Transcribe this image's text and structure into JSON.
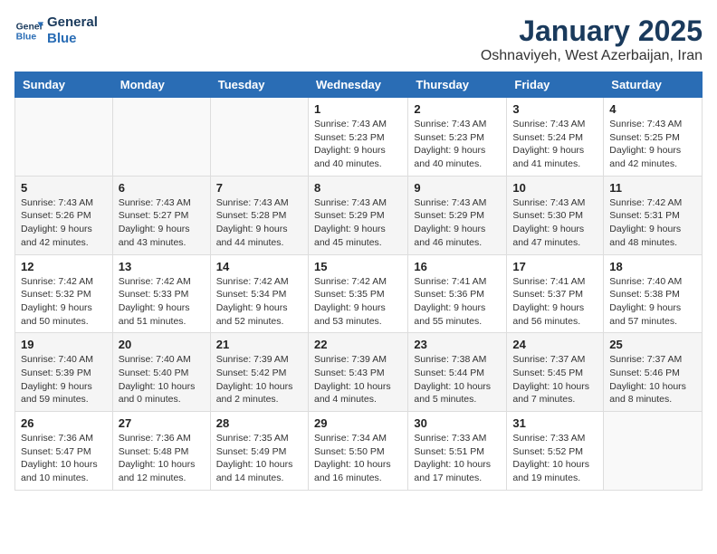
{
  "logo": {
    "line1": "General",
    "line2": "Blue"
  },
  "title": "January 2025",
  "location": "Oshnaviyeh, West Azerbaijan, Iran",
  "weekdays": [
    "Sunday",
    "Monday",
    "Tuesday",
    "Wednesday",
    "Thursday",
    "Friday",
    "Saturday"
  ],
  "weeks": [
    [
      {
        "day": "",
        "info": ""
      },
      {
        "day": "",
        "info": ""
      },
      {
        "day": "",
        "info": ""
      },
      {
        "day": "1",
        "info": "Sunrise: 7:43 AM\nSunset: 5:23 PM\nDaylight: 9 hours\nand 40 minutes."
      },
      {
        "day": "2",
        "info": "Sunrise: 7:43 AM\nSunset: 5:23 PM\nDaylight: 9 hours\nand 40 minutes."
      },
      {
        "day": "3",
        "info": "Sunrise: 7:43 AM\nSunset: 5:24 PM\nDaylight: 9 hours\nand 41 minutes."
      },
      {
        "day": "4",
        "info": "Sunrise: 7:43 AM\nSunset: 5:25 PM\nDaylight: 9 hours\nand 42 minutes."
      }
    ],
    [
      {
        "day": "5",
        "info": "Sunrise: 7:43 AM\nSunset: 5:26 PM\nDaylight: 9 hours\nand 42 minutes."
      },
      {
        "day": "6",
        "info": "Sunrise: 7:43 AM\nSunset: 5:27 PM\nDaylight: 9 hours\nand 43 minutes."
      },
      {
        "day": "7",
        "info": "Sunrise: 7:43 AM\nSunset: 5:28 PM\nDaylight: 9 hours\nand 44 minutes."
      },
      {
        "day": "8",
        "info": "Sunrise: 7:43 AM\nSunset: 5:29 PM\nDaylight: 9 hours\nand 45 minutes."
      },
      {
        "day": "9",
        "info": "Sunrise: 7:43 AM\nSunset: 5:29 PM\nDaylight: 9 hours\nand 46 minutes."
      },
      {
        "day": "10",
        "info": "Sunrise: 7:43 AM\nSunset: 5:30 PM\nDaylight: 9 hours\nand 47 minutes."
      },
      {
        "day": "11",
        "info": "Sunrise: 7:42 AM\nSunset: 5:31 PM\nDaylight: 9 hours\nand 48 minutes."
      }
    ],
    [
      {
        "day": "12",
        "info": "Sunrise: 7:42 AM\nSunset: 5:32 PM\nDaylight: 9 hours\nand 50 minutes."
      },
      {
        "day": "13",
        "info": "Sunrise: 7:42 AM\nSunset: 5:33 PM\nDaylight: 9 hours\nand 51 minutes."
      },
      {
        "day": "14",
        "info": "Sunrise: 7:42 AM\nSunset: 5:34 PM\nDaylight: 9 hours\nand 52 minutes."
      },
      {
        "day": "15",
        "info": "Sunrise: 7:42 AM\nSunset: 5:35 PM\nDaylight: 9 hours\nand 53 minutes."
      },
      {
        "day": "16",
        "info": "Sunrise: 7:41 AM\nSunset: 5:36 PM\nDaylight: 9 hours\nand 55 minutes."
      },
      {
        "day": "17",
        "info": "Sunrise: 7:41 AM\nSunset: 5:37 PM\nDaylight: 9 hours\nand 56 minutes."
      },
      {
        "day": "18",
        "info": "Sunrise: 7:40 AM\nSunset: 5:38 PM\nDaylight: 9 hours\nand 57 minutes."
      }
    ],
    [
      {
        "day": "19",
        "info": "Sunrise: 7:40 AM\nSunset: 5:39 PM\nDaylight: 9 hours\nand 59 minutes."
      },
      {
        "day": "20",
        "info": "Sunrise: 7:40 AM\nSunset: 5:40 PM\nDaylight: 10 hours\nand 0 minutes."
      },
      {
        "day": "21",
        "info": "Sunrise: 7:39 AM\nSunset: 5:42 PM\nDaylight: 10 hours\nand 2 minutes."
      },
      {
        "day": "22",
        "info": "Sunrise: 7:39 AM\nSunset: 5:43 PM\nDaylight: 10 hours\nand 4 minutes."
      },
      {
        "day": "23",
        "info": "Sunrise: 7:38 AM\nSunset: 5:44 PM\nDaylight: 10 hours\nand 5 minutes."
      },
      {
        "day": "24",
        "info": "Sunrise: 7:37 AM\nSunset: 5:45 PM\nDaylight: 10 hours\nand 7 minutes."
      },
      {
        "day": "25",
        "info": "Sunrise: 7:37 AM\nSunset: 5:46 PM\nDaylight: 10 hours\nand 8 minutes."
      }
    ],
    [
      {
        "day": "26",
        "info": "Sunrise: 7:36 AM\nSunset: 5:47 PM\nDaylight: 10 hours\nand 10 minutes."
      },
      {
        "day": "27",
        "info": "Sunrise: 7:36 AM\nSunset: 5:48 PM\nDaylight: 10 hours\nand 12 minutes."
      },
      {
        "day": "28",
        "info": "Sunrise: 7:35 AM\nSunset: 5:49 PM\nDaylight: 10 hours\nand 14 minutes."
      },
      {
        "day": "29",
        "info": "Sunrise: 7:34 AM\nSunset: 5:50 PM\nDaylight: 10 hours\nand 16 minutes."
      },
      {
        "day": "30",
        "info": "Sunrise: 7:33 AM\nSunset: 5:51 PM\nDaylight: 10 hours\nand 17 minutes."
      },
      {
        "day": "31",
        "info": "Sunrise: 7:33 AM\nSunset: 5:52 PM\nDaylight: 10 hours\nand 19 minutes."
      },
      {
        "day": "",
        "info": ""
      }
    ]
  ]
}
